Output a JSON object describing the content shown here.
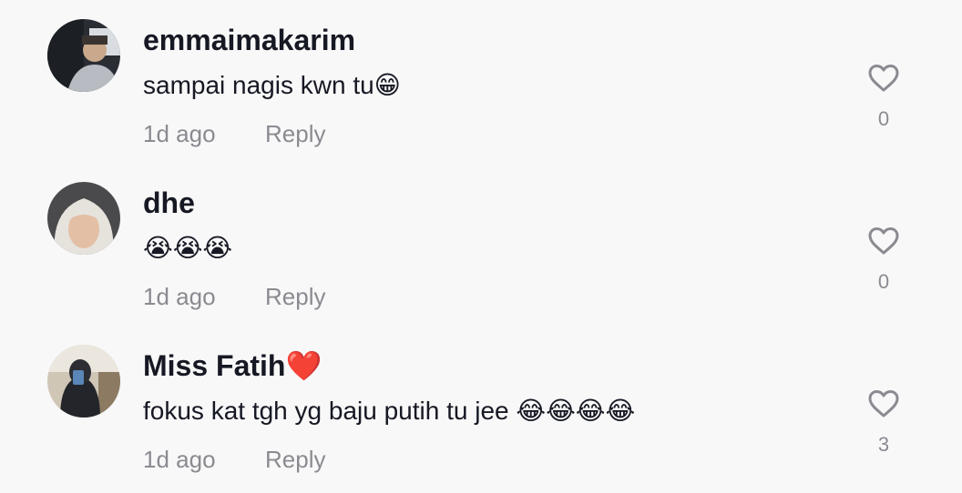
{
  "comments": [
    {
      "username": "emmaimakarim",
      "text": "sampai nagis kwn tu😁",
      "age": "1d ago",
      "reply_label": "Reply",
      "likes": "0",
      "avatar_icon": "user-photo-avatar"
    },
    {
      "username": "dhe",
      "text": "😭😭😭",
      "age": "1d ago",
      "reply_label": "Reply",
      "likes": "0",
      "avatar_icon": "user-photo-avatar"
    },
    {
      "username": "Miss Fatih❤️",
      "text": "fokus kat tgh yg baju putih tu jee 😂😂😂😂",
      "age": "1d ago",
      "reply_label": "Reply",
      "likes": "3",
      "avatar_icon": "user-photo-avatar"
    }
  ],
  "colors": {
    "background": "#f8f8f8",
    "text_primary": "#161823",
    "text_secondary": "#8a8b91"
  },
  "icons": {
    "like": "heart-outline-icon"
  }
}
